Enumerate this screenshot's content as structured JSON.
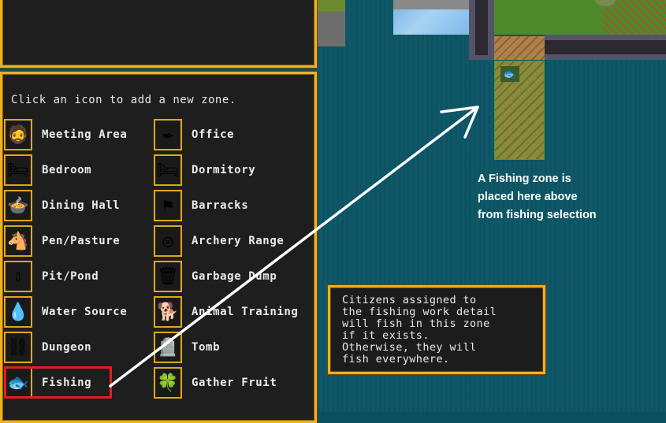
{
  "panel": {
    "instruction": "Click an icon to add a new zone."
  },
  "zones_left": [
    {
      "label": "Meeting Area",
      "icon": "dwarf-icon",
      "glyph": "🧔"
    },
    {
      "label": "Bedroom",
      "icon": "bed-icon",
      "glyph": "🛏"
    },
    {
      "label": "Dining Hall",
      "icon": "food-plate-icon",
      "glyph": "🍲"
    },
    {
      "label": "Pen/Pasture",
      "icon": "horse-icon",
      "glyph": "🐴"
    },
    {
      "label": "Pit/Pond",
      "icon": "pit-arrow-icon",
      "glyph": "⇩"
    },
    {
      "label": "Water Source",
      "icon": "water-barrel-icon",
      "glyph": "💧"
    },
    {
      "label": "Dungeon",
      "icon": "chain-icon",
      "glyph": "⛓"
    },
    {
      "label": "Fishing",
      "icon": "fish-icon",
      "glyph": "🐟"
    }
  ],
  "zones_right": [
    {
      "label": "Office",
      "icon": "quill-desk-icon",
      "glyph": "✒"
    },
    {
      "label": "Dormitory",
      "icon": "bed-icon",
      "glyph": "🛏"
    },
    {
      "label": "Barracks",
      "icon": "banner-icon",
      "glyph": "⚑"
    },
    {
      "label": "Archery Range",
      "icon": "target-icon",
      "glyph": "◎"
    },
    {
      "label": "Garbage Dump",
      "icon": "trash-can-icon",
      "glyph": "🗑"
    },
    {
      "label": "Animal Training",
      "icon": "dog-icon",
      "glyph": "🐕"
    },
    {
      "label": "Tomb",
      "icon": "tombstone-icon",
      "glyph": "🪦"
    },
    {
      "label": "Gather Fruit",
      "icon": "fruit-bush-icon",
      "glyph": "🍀"
    }
  ],
  "tooltip": {
    "text": "Citizens assigned to\nthe fishing work detail\nwill fish in this zone\nif it exists.\nOtherwise, they will\nfish everywhere."
  },
  "annotation": {
    "text": "A Fishing zone is\nplaced here above\nfrom fishing selection"
  },
  "colors": {
    "frame": "#f0b020",
    "highlight": "#e02020",
    "water": "#0c5565",
    "zone_fill": "#8a8a3c"
  }
}
